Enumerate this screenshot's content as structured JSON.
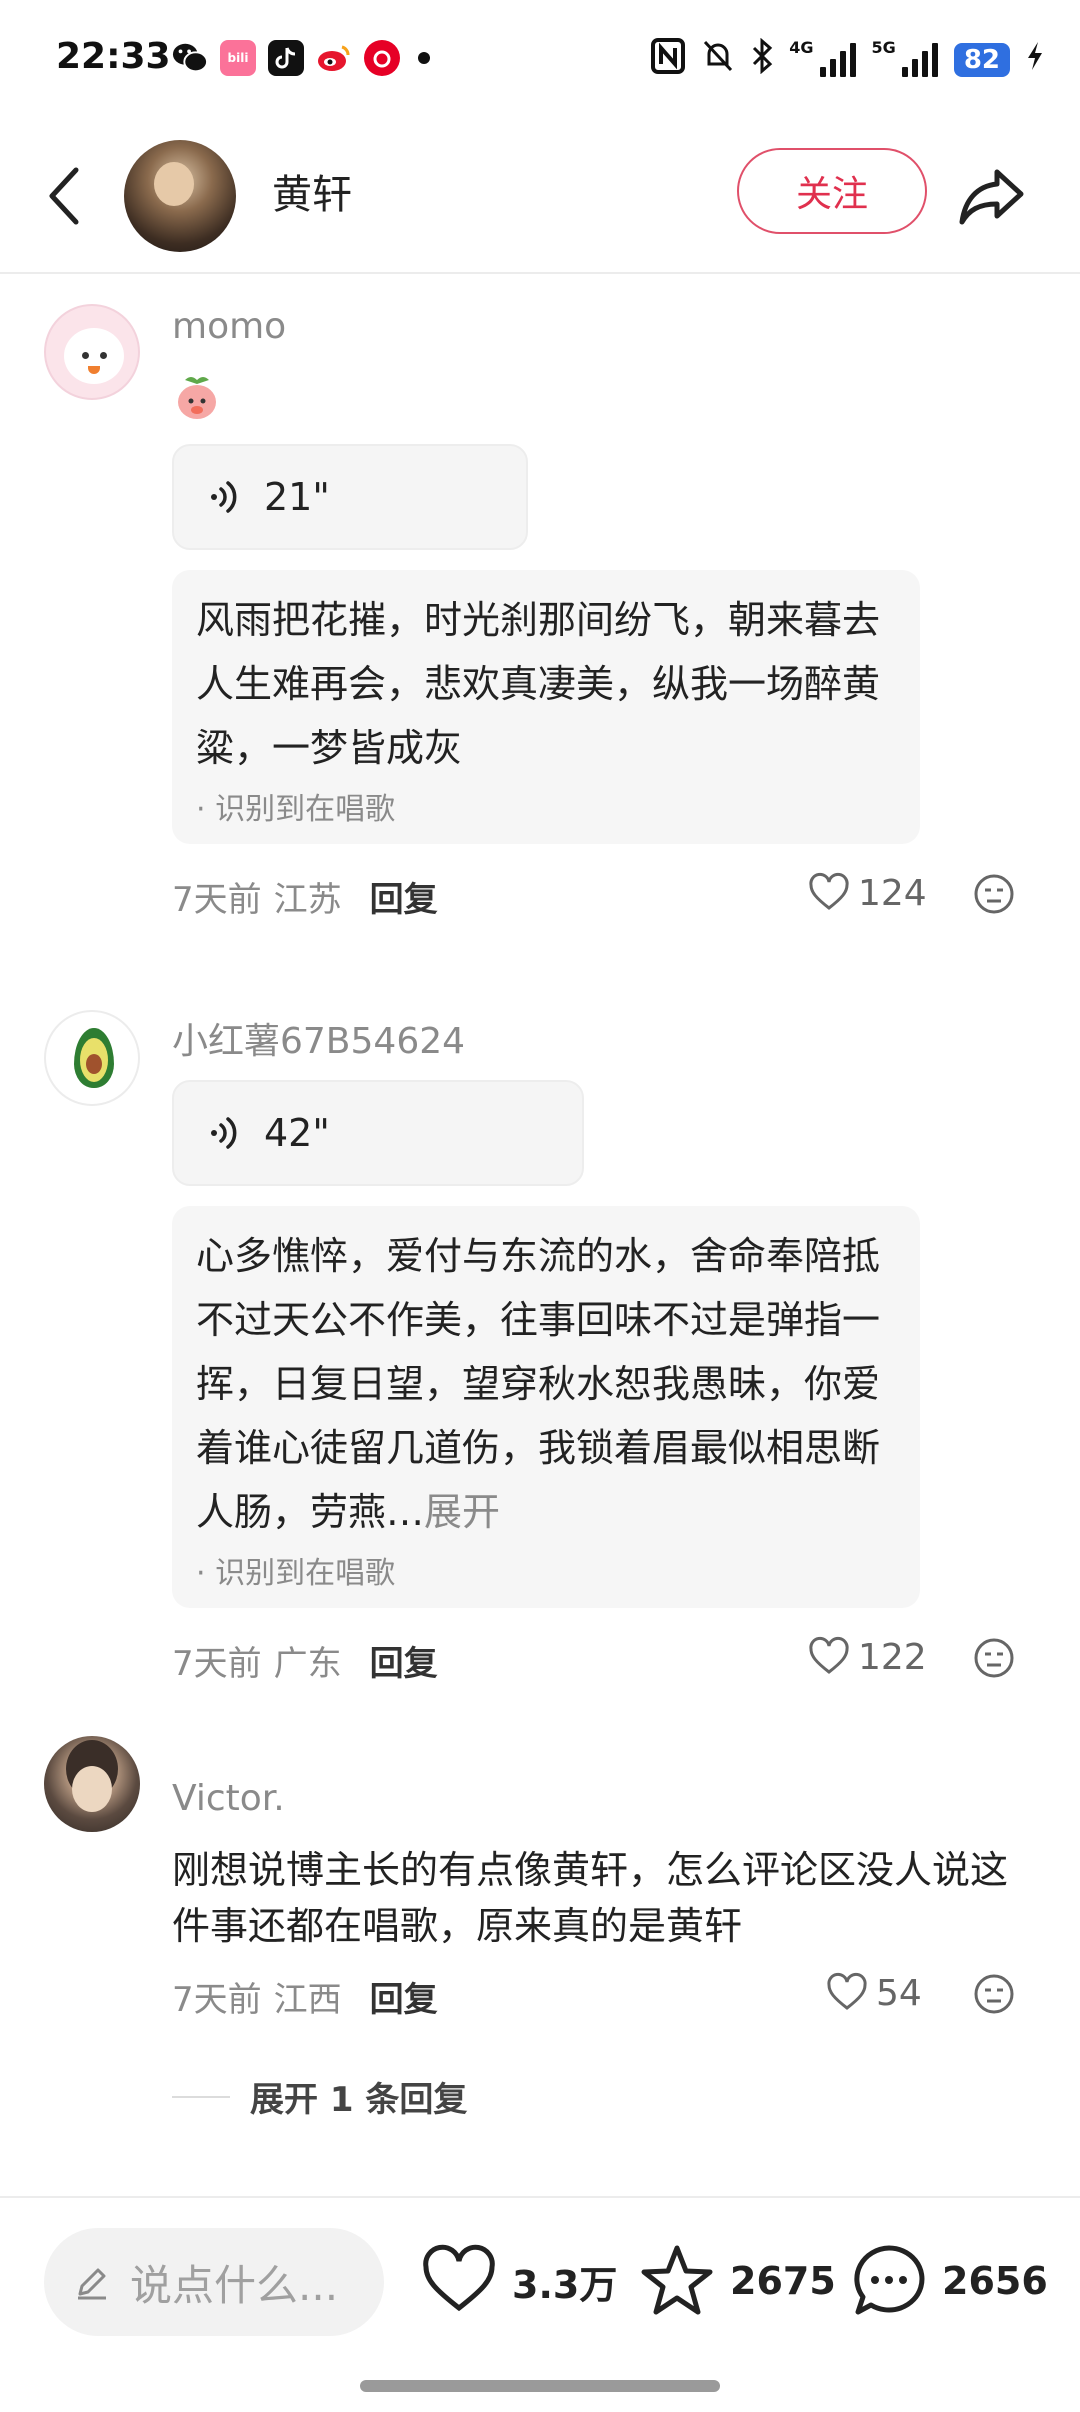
{
  "status_bar": {
    "time": "22:33",
    "network_4g": "4G",
    "network_5g": "5G",
    "battery": "82",
    "notif_icons": [
      "wechat-icon",
      "bilibili-icon",
      "tiktok-icon",
      "weibo-icon",
      "netease-music-icon"
    ]
  },
  "header": {
    "author_name": "黄轩",
    "follow_label": "关注"
  },
  "comments": [
    {
      "username": "momo",
      "has_sticker": true,
      "voice_duration": "21\"",
      "transcript": "风雨把花摧，时光刹那间纷飞，朝来暮去人生难再会，悲欢真凄美，纵我一场醉黄粱，一梦皆成灰",
      "recognized": "· 识别到在唱歌",
      "time": "7天前",
      "location": "江苏",
      "reply_label": "回复",
      "likes": "124"
    },
    {
      "username": "小红薯67B54624",
      "voice_duration": "42\"",
      "transcript": "心多憔悴，爱付与东流的水，舍命奉陪抵不过天公不作美，往事回味不过是弹指一挥，日复日望，望穿秋水恕我愚昧，你爱着谁心徒留几道伤，我锁着眉最似相思断人肠，劳燕…",
      "expand_label": "展开",
      "recognized": "· 识别到在唱歌",
      "time": "7天前",
      "location": "广东",
      "reply_label": "回复",
      "likes": "122"
    },
    {
      "username": "Victor.",
      "text": "刚想说博主长的有点像黄轩，怎么评论区没人说这件事还都在唱歌，原来真的是黄轩",
      "time": "7天前",
      "location": "江西",
      "reply_label": "回复",
      "likes": "54",
      "expand_replies": "展开 1 条回复"
    }
  ],
  "bottom_bar": {
    "input_placeholder": "说点什么...",
    "likes": "3.3万",
    "favorites": "2675",
    "comments": "2656"
  },
  "colors": {
    "accent": "#e0304e",
    "battery": "#2f6fe0",
    "muted_text": "#8a8a8a"
  }
}
